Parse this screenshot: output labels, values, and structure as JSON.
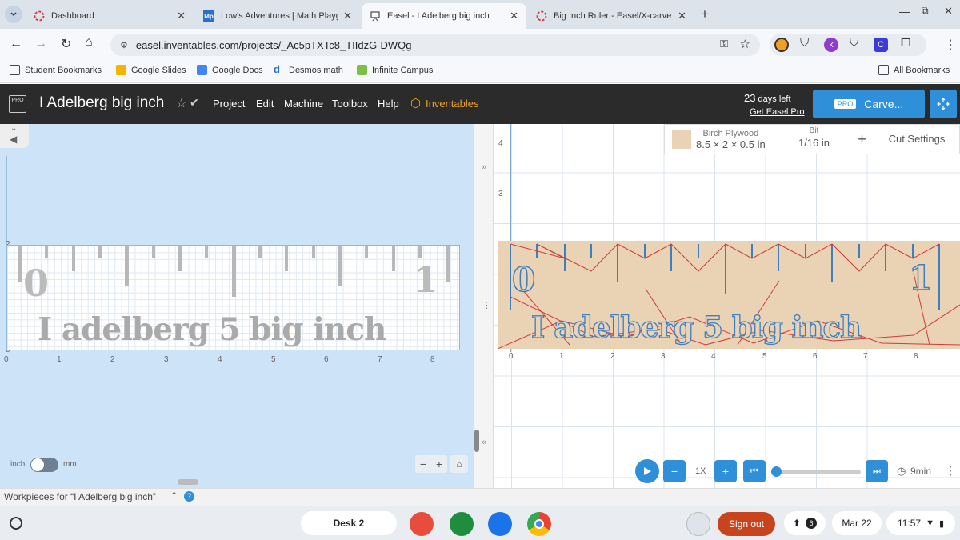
{
  "tabs": [
    {
      "title": "Dashboard"
    },
    {
      "title": "Low's Adventures | Math Playg"
    },
    {
      "title": "Easel - I Adelberg big inch"
    },
    {
      "title": "Big Inch Ruler - Easel/X-carve"
    }
  ],
  "address": "easel.inventables.com/projects/_Ac5pTXTc8_TIIdzG-DWQg",
  "bookmarks": [
    "Student Bookmarks",
    "Google Slides",
    "Google Docs",
    "Desmos math",
    "Infinite Campus"
  ],
  "all_bookmarks": "All Bookmarks",
  "easel": {
    "pro_badge": "PRO",
    "project_title": "I Adelberg big inch",
    "menu": [
      "Project",
      "Edit",
      "Machine",
      "Toolbox",
      "Help"
    ],
    "inventables": "Inventables",
    "days_left": "23",
    "days_left_suffix": "days left",
    "get_pro": "Get Easel Pro",
    "carve_pro": "PRO",
    "carve_label": "Carve..."
  },
  "design": {
    "y_ticks": [
      "2",
      "1",
      "0"
    ],
    "x_ticks": [
      "0",
      "1",
      "2",
      "3",
      "4",
      "5",
      "6",
      "7",
      "8"
    ],
    "ruler_zero": "0",
    "ruler_one": "1",
    "ruler_text": "I adelberg 5 big inch",
    "unit_inch": "inch",
    "unit_mm": "mm"
  },
  "preview": {
    "material_label": "Birch Plywood",
    "material_size": "8.5 × 2 × 0.5 in",
    "bit_label": "Bit",
    "bit_value": "1/16 in",
    "plus": "+",
    "cut_settings": "Cut Settings",
    "y_ticks": [
      "4",
      "3"
    ],
    "x_ticks": [
      "0",
      "1",
      "2",
      "3",
      "4",
      "5",
      "6",
      "7",
      "8"
    ],
    "ruler_zero": "0",
    "ruler_one": "1",
    "ruler_text": "I adelberg 5 big inch",
    "speed": "1X",
    "time": "9min",
    "progress": 0
  },
  "workpieces": "Workpieces for “I Adelberg big inch”",
  "shelf": {
    "desk": "Desk 2",
    "signout": "Sign out",
    "notif_count": "6",
    "date": "Mar 22",
    "time": "11:57"
  },
  "colors": {
    "accent": "#2f8fd8",
    "header": "#2b2b2b",
    "wood": "#e9d3b4",
    "signout": "#c8441c"
  }
}
